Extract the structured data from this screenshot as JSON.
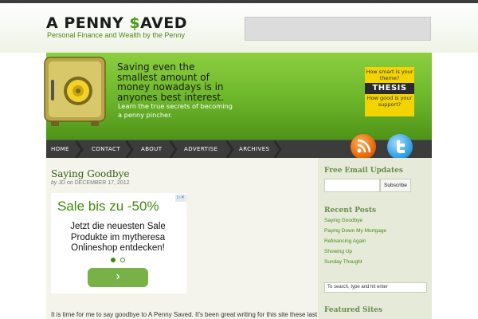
{
  "site": {
    "title_part1": "A PENNY ",
    "title_dollar": "$",
    "title_part2": "AVED",
    "tagline": "Personal Finance and Wealth by the Penny"
  },
  "banner": {
    "headline": "Saving even the smallest amount of money nowadays is in anyones best interest.",
    "subtext": "Learn the true secrets of becoming a penny pincher."
  },
  "thesis_ad": {
    "line1": "How smart is your theme?",
    "brand": "THESIS",
    "line2": "How good is your support?"
  },
  "nav": {
    "items": [
      {
        "label": "HOME"
      },
      {
        "label": "CONTACT"
      },
      {
        "label": "ABOUT"
      },
      {
        "label": "ADVERTISE"
      },
      {
        "label": "ARCHIVES"
      }
    ]
  },
  "social": {
    "icons": [
      "rss-icon",
      "twitter-icon"
    ]
  },
  "post": {
    "title": "Saying Goodbye",
    "byline_by": "by",
    "author": "JD",
    "byline_on": "on",
    "date": "DECEMBER 17, 2012",
    "body_start": "It is time for me to say goodbye to A Penny Saved. It's been great writing for this site these last"
  },
  "inline_ad": {
    "badge": "▷✕",
    "headline": "Sale bis zu -50%",
    "text": "Jetzt die neuesten Sale Produkte im mytheresa Onlineshop entdecken!",
    "button_glyph": "›",
    "accent": "#3f8a0e"
  },
  "sidebar": {
    "email_heading": "Free Email Updates",
    "subscribe_label": "Subscribe",
    "recent_heading": "Recent Posts",
    "recent_posts": [
      "Saying Goodbye",
      "Paying Down My Mortgage",
      "Refinancing Again",
      "Showing Up",
      "Sunday Thought"
    ],
    "search_placeholder": "To search, type and hit enter",
    "featured_heading": "Featured Sites"
  },
  "colors": {
    "brand_green": "#4e9a18",
    "nav_bg": "#3c3c3c",
    "thesis_yellow": "#f3d400"
  }
}
